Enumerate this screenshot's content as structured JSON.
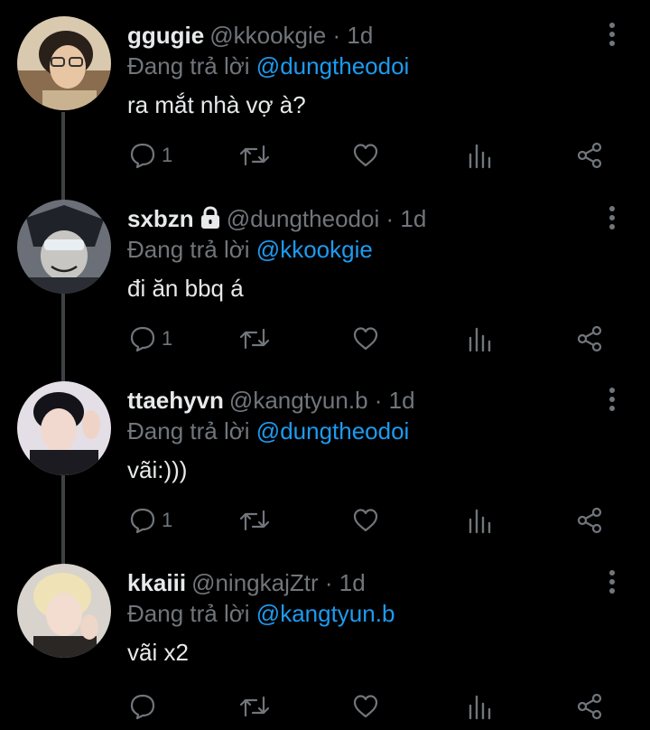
{
  "colors": {
    "background": "#000000",
    "primary_text": "#e7e9ea",
    "secondary_text": "#71767b",
    "mention": "#1d9bf0",
    "thread_line": "#3e4144"
  },
  "reply_prefix": "Đang trả lời",
  "separator": "·",
  "icons": {
    "more": "more-vertical-icon",
    "reply": "reply-icon",
    "retweet": "retweet-icon",
    "like": "heart-icon",
    "views": "analytics-icon",
    "share": "share-icon",
    "protected": "lock-icon"
  },
  "tweets": [
    {
      "name": "ggugie",
      "handle": "@kkookgie",
      "time": "1d",
      "replying_to": "@dungtheodoi",
      "text": "ra mắt nhà vợ à?",
      "reply_count": "1",
      "protected": false
    },
    {
      "name": "sxbzn",
      "handle": "@dungtheodoi",
      "time": "1d",
      "replying_to": "@kkookgie",
      "text": "đi ăn bbq á",
      "reply_count": "1",
      "protected": true
    },
    {
      "name": "ttaehyvn",
      "handle": "@kangtyun.b",
      "time": "1d",
      "replying_to": "@dungtheodoi",
      "text": "vãi:)))",
      "reply_count": "1",
      "protected": false
    },
    {
      "name": "kkaiii",
      "handle": "@ningkajZtr",
      "time": "1d",
      "replying_to": "@kangtyun.b",
      "text": "vãi x2",
      "reply_count": "",
      "protected": false
    }
  ]
}
